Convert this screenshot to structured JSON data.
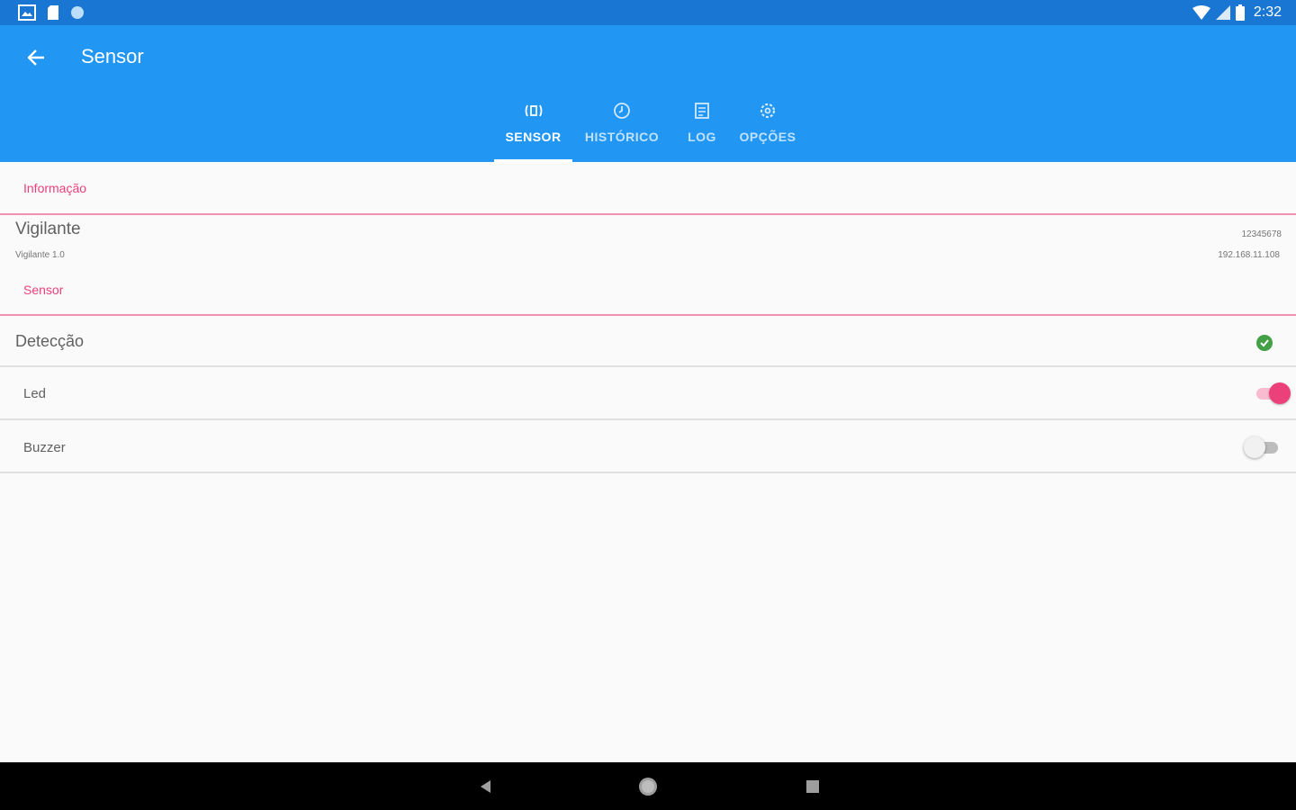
{
  "status_bar": {
    "time": "2:32",
    "left_icons": [
      "image-notification-icon",
      "sd-card-icon",
      "circle-notification-icon"
    ],
    "right_icons": [
      "wifi-icon",
      "cell-signal-icon",
      "battery-icon"
    ]
  },
  "app_bar": {
    "title": "Sensor",
    "back_icon": "arrow-left-icon"
  },
  "tabs": [
    {
      "label": "SENSOR",
      "icon": "sensor-icon",
      "active": true
    },
    {
      "label": "HISTÓRICO",
      "icon": "clock-icon",
      "active": false
    },
    {
      "label": "LOG",
      "icon": "log-icon",
      "active": false
    },
    {
      "label": "OPÇÕES",
      "icon": "settings-icon",
      "active": false
    }
  ],
  "info_section": {
    "header": "Informação",
    "device_name": "Vigilante",
    "device_version": "Vigilante 1.0",
    "device_id": "12345678",
    "device_ip": "192.168.11.108"
  },
  "sensor_section": {
    "header": "Sensor",
    "detection_label": "Detecção",
    "detection_status_icon": "check-circle-icon",
    "led_label": "Led",
    "led_on": true,
    "buzzer_label": "Buzzer",
    "buzzer_on": false
  },
  "colors": {
    "status_bar": "#1976d2",
    "app_bar": "#2196f3",
    "accent": "#ec407a",
    "status_ok": "#43a047"
  },
  "nav_bar": {
    "icons": [
      "back-triangle-icon",
      "home-circle-icon",
      "recents-square-icon"
    ]
  }
}
